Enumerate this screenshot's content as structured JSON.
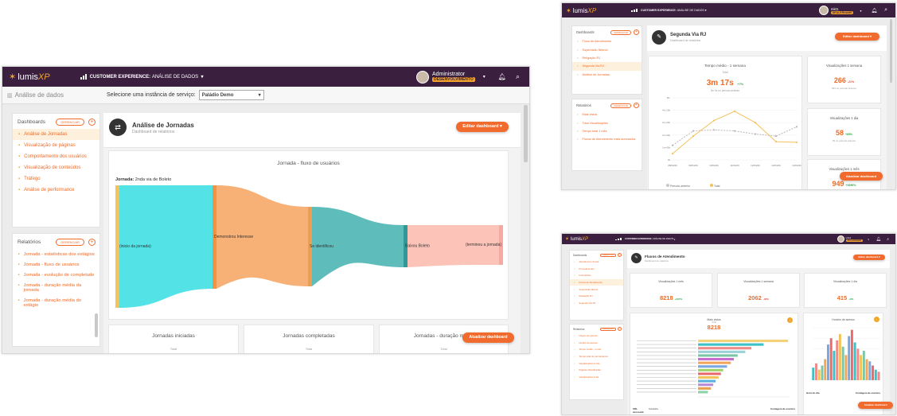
{
  "brand": {
    "lumis": "lumis",
    "xp": "XP"
  },
  "main": {
    "context_prefix": "CUSTOMER EXPERIENCE:",
    "context_value": "ANÁLISE DE DADOS",
    "user_name": "Administrator",
    "user_tag": "DESENVOLVIMENTO",
    "breadcrumb": "Análise de dados",
    "instance_label": "Selecione uma instância de serviço:",
    "instance_value": "Paládio Demo",
    "dashboards_title": "Dashboards",
    "manage_label": "GERENCIAR",
    "dashboards": [
      "Análise de Jornadas",
      "Visualização de páginas",
      "Comportamento dos usuários",
      "Visualização de conteúdos",
      "Tráfego",
      "Análise de performance"
    ],
    "reports_title": "Relatórios",
    "reports": [
      "Jornada - estatísticas dos estágios",
      "Jornada - fluxo de usuários",
      "Jornada - evolução de completude",
      "Jornada - duração média da jornada",
      "Jornada - duração média do estágio"
    ],
    "page_title": "Análise de Jornadas",
    "page_subtitle": "Dashboard de relatórios",
    "edit_button": "Editar dashboard",
    "sankey_title": "Jornada - fluxo de usuários",
    "journey_label": "Jornada:",
    "journey_value": "2nda via de Boleto",
    "sankey_nodes": [
      "(inicio da jornada)",
      "Demonstrou Interesse",
      "Se identificou",
      "Baixou Boleto",
      "(terminou a jornada)"
    ],
    "cards": [
      "Jornadas iniciadas",
      "Jornadas completadas",
      "Jornadas - duração média"
    ],
    "card_sub": "Total",
    "update_button": "Atualizar dashboard"
  },
  "top_right": {
    "context_prefix": "CUSTOMER EXPERIENCE:",
    "context_value": "ANÁLISE DE DADOS",
    "user_name": "mkt1",
    "user_tag": "DEALERNAME",
    "dashboards_title": "Dashboards",
    "manage_label": "GERENCIAR",
    "dashboards": [
      "Fluxo de Atendimento",
      "Supervisão Nitenói",
      "Religação RJ",
      "Segunda Via RJ",
      "Análise de Jornadas"
    ],
    "reports_title": "Relatórios",
    "reports": [
      "Mais vistos",
      "Total Visualizações",
      "Tempo total 1 mês",
      "Fluxos de Atendimento mais acessados"
    ],
    "page_title": "Segunda Via RJ",
    "page_subtitle": "Dashboard de relatórios",
    "edit_button": "Editar dashboard",
    "chart_title": "Tempo médio - 1 semana",
    "total_label": "Total",
    "total_value": "3m 17s",
    "total_delta": "+7%",
    "total_note": "3m 6s no período anterior",
    "kpis": [
      {
        "title": "Visualizações 1 semana",
        "value": "266",
        "delta": "-21%",
        "note": "333 no período anterior"
      },
      {
        "title": "Visualizações 1 dia",
        "value": "58",
        "delta": "+65%",
        "note": "35 no período anterior"
      },
      {
        "title": "Visualizações 1 mês",
        "value": "949",
        "delta": "+5390%",
        "note": ""
      }
    ],
    "legend": [
      "Período anterior",
      "Total"
    ],
    "update_button": "Atualizar dashboard"
  },
  "bottom_right": {
    "context_prefix": "CUSTOMER EXPERIENCE:",
    "context_value": "ANÁLISE DE DADOS",
    "user_name": "mkt1",
    "user_tag": "DEALERNAME",
    "dashboards_title": "Dashboards",
    "manage_label": "GERENCIAR",
    "dashboards": [
      "Atendimento Social",
      "Procedimentos",
      "Formulários",
      "Fluxos de Atendimento",
      "Supervisão Niterói",
      "Religação RJ",
      "Segunda Via RJ"
    ],
    "reports_title": "Relatórios",
    "reports": [
      "Origem de acesso",
      "Horário de acesso",
      "Tempo médio - 1 mês",
      "Tempo total de permanência",
      "Visualizações 1 mês",
      "Páginas Visualizadas",
      "Visualizações 1 dia"
    ],
    "page_title": "Fluxos de Atendimento",
    "page_subtitle": "Dashboard de relatórios",
    "edit_button": "Editar dashboard",
    "kpis": [
      {
        "title": "Visualizações 1 mês",
        "value": "8218",
        "delta": "+297%"
      },
      {
        "title": "Visualizações 1 semana",
        "value": "2062",
        "delta": "-33%"
      },
      {
        "title": "Visualizações 1 dia",
        "value": "415",
        "delta": "+6%"
      }
    ],
    "bar_title": "Mais vistos",
    "bar_total_label": "Total",
    "bar_total_value": "8218",
    "hour_title": "Horário de acesso",
    "table_headers": [
      "URL acessada",
      "Caminho",
      "Contagem de eventos"
    ],
    "hour_headers": [
      "Hora do dia",
      "Contagem de eventos"
    ],
    "update_button": "Atualizar dashboard"
  },
  "chart_data": [
    {
      "type": "line",
      "title": "Tempo médio - 1 semana",
      "categories": [
        "08/04/20",
        "09/04/20",
        "10/04/20",
        "11/04/20",
        "12/04/20",
        "13/04/20",
        "14/04/20"
      ],
      "series": [
        {
          "name": "Total",
          "values": [
            30,
            115,
            190,
            235,
            180,
            88,
            85
          ]
        },
        {
          "name": "Período anterior",
          "values": [
            70,
            140,
            145,
            140,
            125,
            115,
            160
          ]
        }
      ],
      "y_ticks": [
        "0s",
        "1m 40s",
        "2m 30s",
        "3m 20s",
        "4m 10s",
        "5m"
      ],
      "ylim": [
        0,
        300
      ]
    },
    {
      "type": "bar",
      "title": "Mais vistos",
      "values": [
        1180,
        860,
        700,
        620,
        520,
        470,
        430,
        380,
        330,
        300,
        270,
        230,
        200,
        170,
        130
      ],
      "ylim": [
        0,
        1200
      ]
    },
    {
      "type": "bar",
      "title": "Horário de acesso",
      "categories": [
        "1",
        "2",
        "3",
        "4",
        "5",
        "6",
        "7",
        "8",
        "9",
        "10",
        "11",
        "12",
        "13",
        "14",
        "15",
        "16",
        "17",
        "18",
        "19",
        "20",
        "21",
        "22",
        "23"
      ],
      "values": [
        30,
        40,
        25,
        35,
        50,
        85,
        100,
        70,
        95,
        110,
        80,
        60,
        105,
        120,
        90,
        75,
        60,
        70,
        50,
        45,
        35,
        25,
        20
      ],
      "ylim": [
        0,
        125
      ]
    }
  ],
  "colors": {
    "topbar": "#3a1f3f",
    "accent": "#f26b2e",
    "highlight": "#f3a52b",
    "sankey": [
      "#40e0e4",
      "#f6a766",
      "#4cb5b4",
      "#fcbdb0"
    ]
  }
}
